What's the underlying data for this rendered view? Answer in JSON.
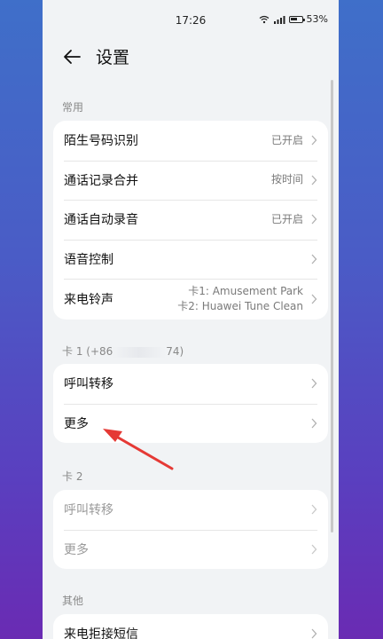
{
  "status_bar": {
    "time": "17:26",
    "battery": "53%"
  },
  "header": {
    "title": "设置"
  },
  "sections": {
    "common": {
      "label": "常用",
      "items": [
        {
          "title": "陌生号码识别",
          "value": "已开启"
        },
        {
          "title": "通话记录合并",
          "value": "按时间"
        },
        {
          "title": "通话自动录音",
          "value": "已开启"
        },
        {
          "title": "语音控制",
          "value": ""
        },
        {
          "title": "来电铃声",
          "value_line1": "卡1: Amusement Park",
          "value_line2": "卡2: Huawei Tune Clean"
        }
      ]
    },
    "card1": {
      "label_prefix": "卡 1 (+86",
      "label_suffix": "74)",
      "items": [
        {
          "title": "呼叫转移"
        },
        {
          "title": "更多"
        }
      ]
    },
    "card2": {
      "label": "卡 2",
      "items": [
        {
          "title": "呼叫转移"
        },
        {
          "title": "更多"
        }
      ]
    },
    "other": {
      "label": "其他",
      "items": [
        {
          "title": "来电拒接短信"
        }
      ]
    }
  },
  "colors": {
    "annotation_arrow": "#e53935",
    "background_top": "#3f6fc9",
    "background_bottom": "#6a2bb3"
  }
}
